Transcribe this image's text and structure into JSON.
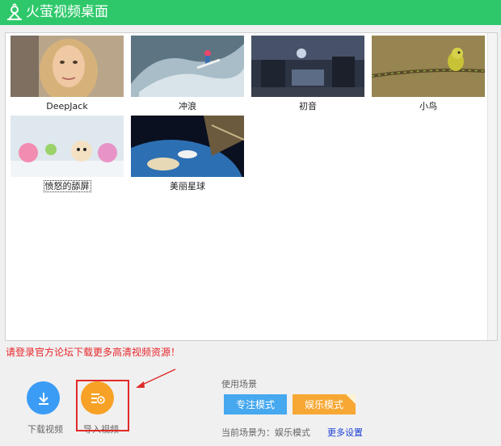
{
  "app": {
    "title": "火萤视频桌面"
  },
  "videos": [
    {
      "label": "DeepJack"
    },
    {
      "label": "冲浪"
    },
    {
      "label": "初音"
    },
    {
      "label": "小鸟"
    },
    {
      "label": "愤怒的舔屏"
    },
    {
      "label": "美丽星球"
    }
  ],
  "notice": "请登录官方论坛下载更多高清视频资源！",
  "actions": {
    "download_label": "下载视频",
    "import_label": "导入视频"
  },
  "scene": {
    "heading": "使用场景",
    "focus_mode": "专注模式",
    "entertainment_mode": "娱乐模式",
    "current": "当前场景为：娱乐模式",
    "more_settings": "更多设置"
  },
  "colors": {
    "titlebar": "#2ec86a",
    "notice": "#e8262b",
    "download_button": "#3b9cf5",
    "import_button": "#f7a226",
    "focus_button": "#46a8ee",
    "entertainment_button": "#f7a834",
    "highlight": "#e12a2a",
    "link": "#1a3fd6"
  }
}
